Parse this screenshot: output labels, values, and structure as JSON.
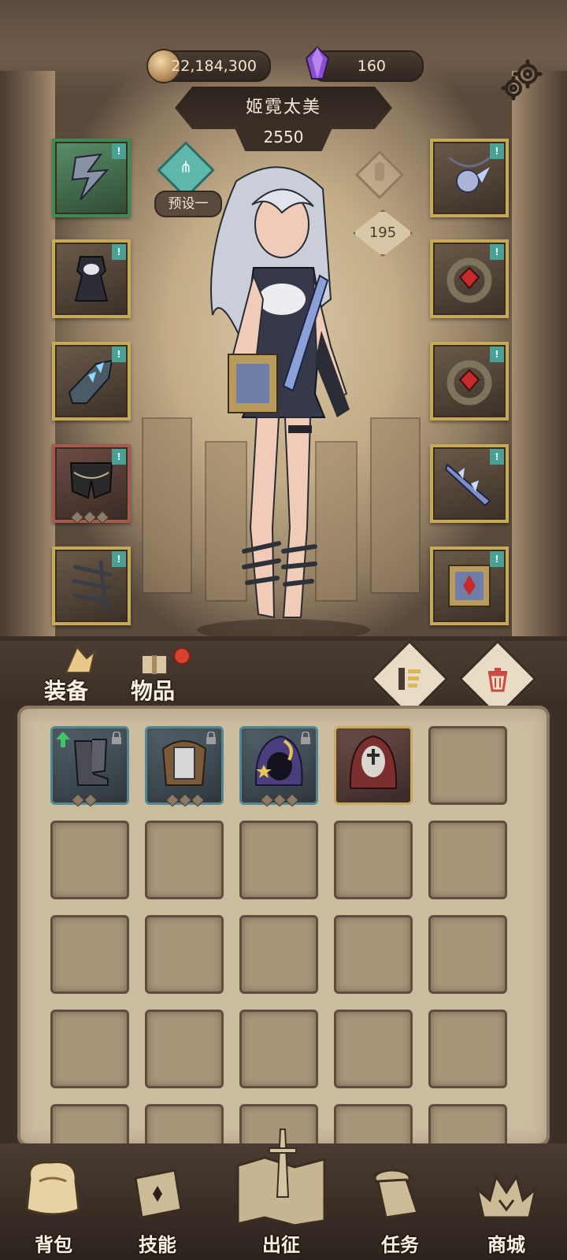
{
  "resources": {
    "gold": "22,184,300",
    "gems": "160"
  },
  "character": {
    "name": "姬霓太美",
    "power": "2550",
    "preset_label": "预设一",
    "level": "195"
  },
  "bag": {
    "tab_equipment": "装备",
    "tab_items": "物品",
    "items": [
      {
        "icon": "boots-icon",
        "locked": true,
        "upgrade": true,
        "rarity": "blue"
      },
      {
        "icon": "armor-icon",
        "locked": true,
        "upgrade": false,
        "rarity": "blue"
      },
      {
        "icon": "hood-icon",
        "locked": true,
        "upgrade": false,
        "rarity": "blue"
      },
      {
        "icon": "nun-hood-icon",
        "locked": false,
        "upgrade": false,
        "rarity": "gold"
      }
    ]
  },
  "nav": {
    "bag": "背包",
    "skills": "技能",
    "expedition": "出征",
    "quests": "任务",
    "shop": "商城"
  },
  "colors": {
    "accent_teal": "#4aa095",
    "gold_border": "#c7a95a",
    "red_badge": "#d9412f"
  }
}
